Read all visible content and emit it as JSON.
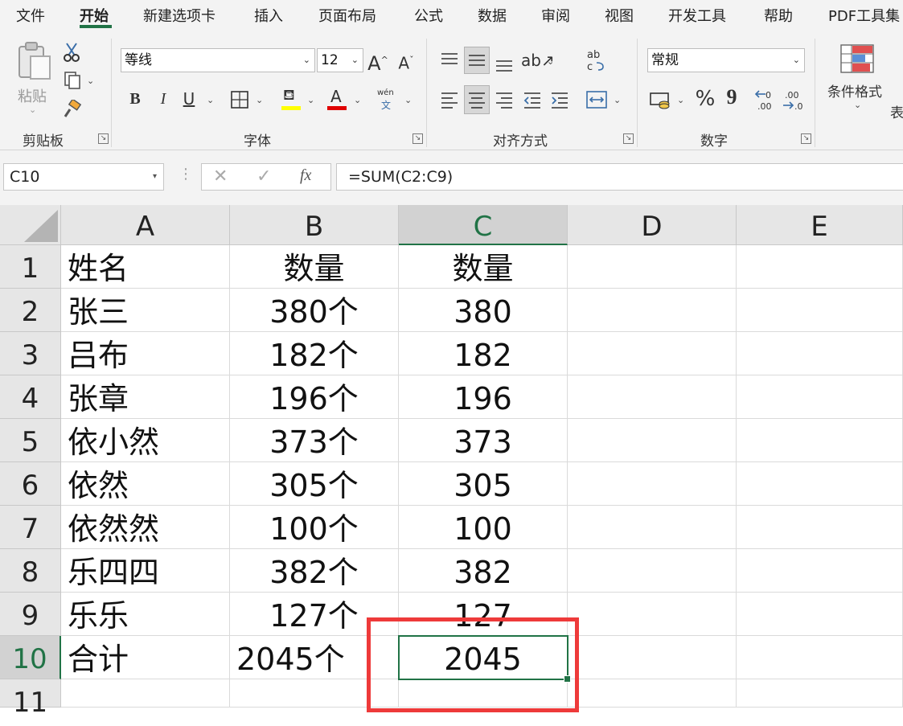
{
  "tabs": [
    "文件",
    "开始",
    "新建选项卡",
    "插入",
    "页面布局",
    "公式",
    "数据",
    "审阅",
    "视图",
    "开发工具",
    "帮助",
    "PDF工具集"
  ],
  "active_tab_index": 1,
  "ribbon": {
    "clipboard": {
      "paste_label": "粘贴",
      "group_label": "剪贴板"
    },
    "font": {
      "font_name": "等线",
      "font_size": "12",
      "bold": "B",
      "italic": "I",
      "underline": "U",
      "font_color_glyph": "A",
      "phonetic_top": "wén",
      "phonetic_bottom": "文",
      "group_label": "字体",
      "fill_color": "#ffff00",
      "font_color": "#e00000"
    },
    "alignment": {
      "group_label": "对齐方式"
    },
    "number": {
      "format": "常规",
      "percent": "%",
      "comma": "9",
      "group_label": "数字"
    },
    "styles": {
      "conditional_format": "条件格式",
      "cut_off": "表"
    }
  },
  "formula_bar": {
    "name_box": "C10",
    "fx": "fx",
    "formula": "=SUM(C2:C9)"
  },
  "sheet": {
    "columns": [
      "A",
      "B",
      "C",
      "D",
      "E"
    ],
    "rows": [
      {
        "num": "1",
        "a": "姓名",
        "b": "数量",
        "c": "数量"
      },
      {
        "num": "2",
        "a": "张三",
        "b": "380个",
        "c": "380"
      },
      {
        "num": "3",
        "a": "吕布",
        "b": "182个",
        "c": "182"
      },
      {
        "num": "4",
        "a": "张章",
        "b": "196个",
        "c": "196"
      },
      {
        "num": "5",
        "a": "依小然",
        "b": "373个",
        "c": "373"
      },
      {
        "num": "6",
        "a": "依然",
        "b": "305个",
        "c": "305"
      },
      {
        "num": "7",
        "a": "依然然",
        "b": "100个",
        "c": "100"
      },
      {
        "num": "8",
        "a": "乐四四",
        "b": "382个",
        "c": "382"
      },
      {
        "num": "9",
        "a": "乐乐",
        "b": "127个",
        "c": "127"
      },
      {
        "num": "10",
        "a": "合计",
        "b": "2045个",
        "c": "2045"
      },
      {
        "num": "11",
        "a": "",
        "b": "",
        "c": ""
      }
    ],
    "active_cell": "C10",
    "accent_color": "#217346",
    "highlight_color": "#ee3a3a"
  }
}
